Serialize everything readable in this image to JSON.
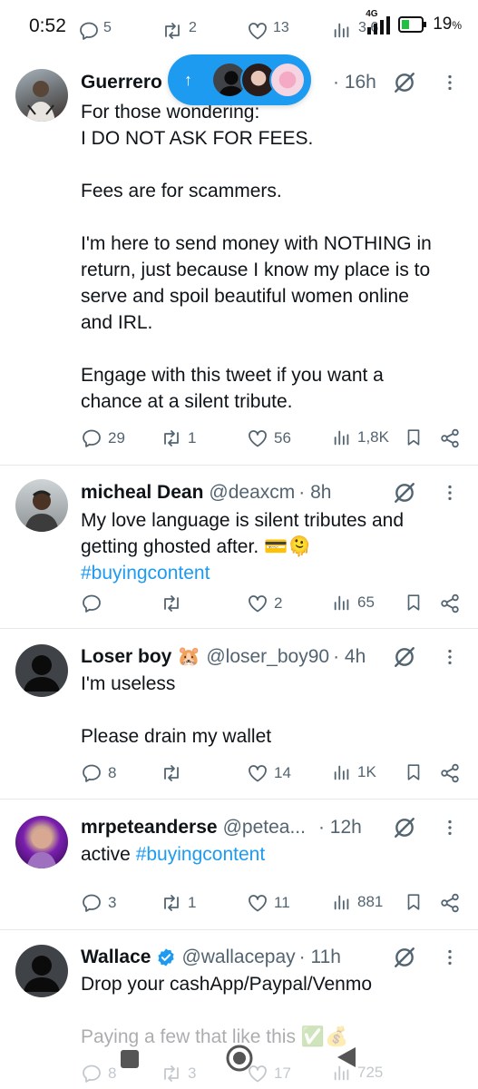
{
  "status_bar": {
    "time": "0:52",
    "faded_reply": "5",
    "faded_retweet": "2",
    "faded_like": "13",
    "faded_views": "3,6",
    "network": "4G",
    "battery": "19"
  },
  "scroll_pill": {
    "arrow": "↑"
  },
  "tweets": [
    {
      "name": "Guerrero",
      "handle": "",
      "time": "· 16h",
      "lines": [
        "For those wondering:",
        "I DO NOT ASK FOR FEES.",
        "",
        "Fees are for scammers.",
        "",
        "I'm here to send money with NOTHING in",
        "return, just because I know my place is to",
        "serve and spoil beautiful women online",
        "and IRL.",
        "",
        "Engage with this tweet if you want a",
        "chance at a silent tribute."
      ],
      "replies": "29",
      "retweets": "1",
      "likes": "56",
      "views": "1,8K"
    },
    {
      "name": "micheal Dean",
      "handle": "@deaxcm",
      "time": "· 8h",
      "line1": "My love language is silent tributes and",
      "line2": "getting ghosted after. 💳🫠",
      "hashtag": "#buyingcontent",
      "replies": "",
      "retweets": "",
      "likes": "2",
      "views": "65"
    },
    {
      "name": "Loser boy 🐹",
      "handle": "@loser_boy90",
      "time": "· 4h",
      "lines": [
        "I'm useless",
        "",
        "Please drain my wallet"
      ],
      "replies": "8",
      "retweets": "",
      "likes": "14",
      "views": "1K"
    },
    {
      "name": "mrpeteanderse",
      "handle": "@petea...",
      "time": "· 12h",
      "text": "active ",
      "hashtag": "#buyingcontent",
      "replies": "3",
      "retweets": "1",
      "likes": "11",
      "views": "881"
    },
    {
      "name": "Wallace",
      "handle": "@wallacepay",
      "time": "· 11h",
      "line1": "Drop your cashApp/Paypal/Venmo",
      "line3": "Paying a few that like this ✅💰",
      "replies": "8",
      "retweets": "3",
      "likes": "17",
      "views": "725"
    }
  ],
  "colors": {
    "accent": "#1d9bf0",
    "text": "#0f1419",
    "muted": "#536471",
    "verified": "#1d9bf0"
  },
  "icons": [
    "reply-icon",
    "retweet-icon",
    "like-icon",
    "views-icon",
    "bookmark-icon",
    "share-icon",
    "grok-icon",
    "more-icon",
    "verified-icon"
  ]
}
